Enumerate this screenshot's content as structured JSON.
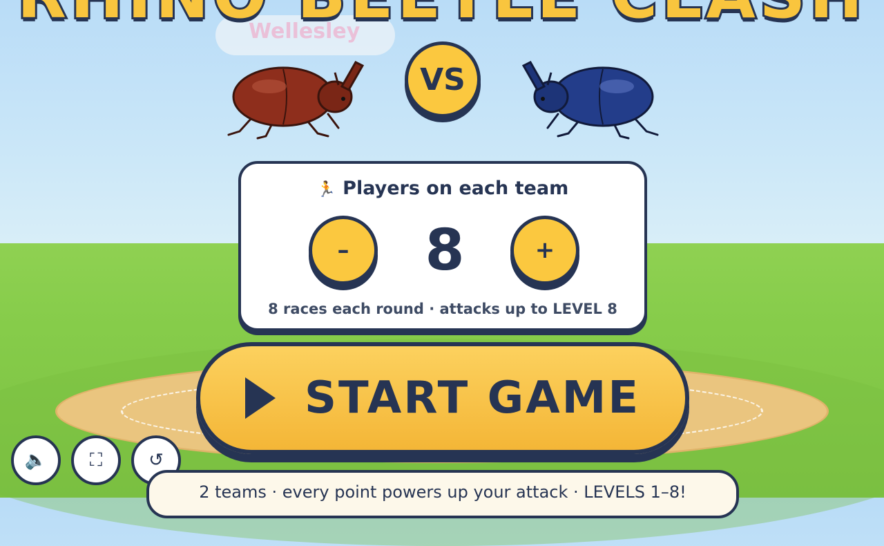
{
  "title": "RHINO BEETLE CLASH",
  "watermark": "Wellesley",
  "vs_label": "VS",
  "players_card": {
    "icon": "runner-icon",
    "icon_glyph": "🏃",
    "title": "Players on each team",
    "minus_label": "–",
    "plus_label": "+",
    "count": "8",
    "subtitle": "8 races each round · attacks up to LEVEL 8"
  },
  "start_button": {
    "label": "START GAME",
    "icon": "play-icon"
  },
  "corner_buttons": [
    {
      "name": "sound-icon",
      "glyph": "🔈"
    },
    {
      "name": "fullscreen-icon",
      "glyph": "⛶"
    },
    {
      "name": "restart-icon",
      "glyph": "↺"
    }
  ],
  "footer": "2 teams · every point powers up your attack · LEVELS 1–8!",
  "colors": {
    "accent": "#fbc83f",
    "outline": "#263453",
    "red_beetle": "#8e2e1c",
    "blue_beetle": "#233d8a",
    "sky": "#c9e6f8",
    "grass": "#86cc4a"
  }
}
